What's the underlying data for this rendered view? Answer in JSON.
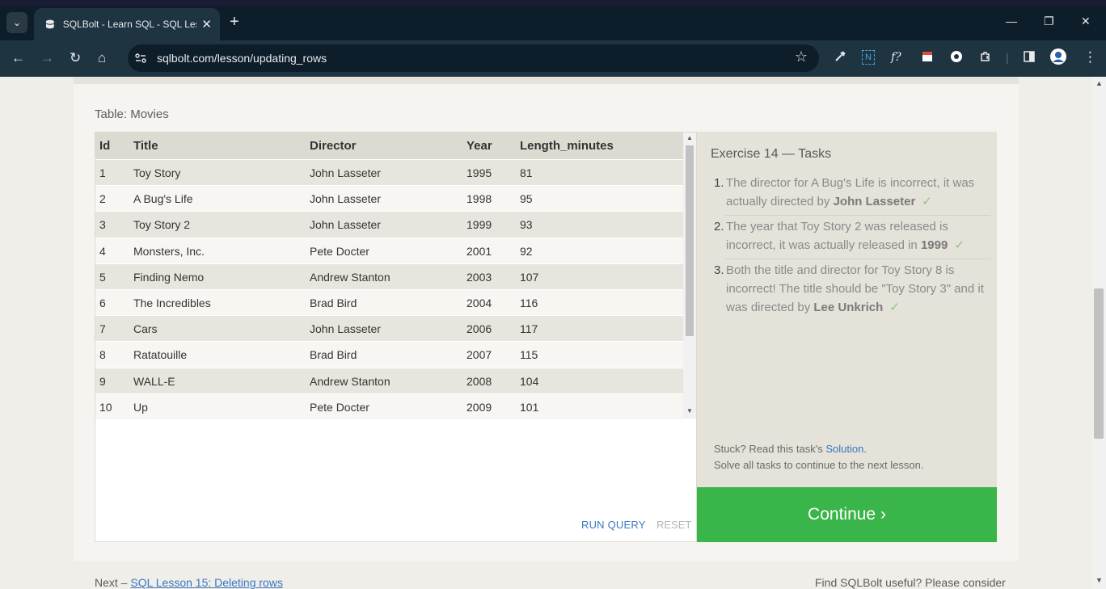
{
  "browser": {
    "tab_title": "SQLBolt - Learn SQL - SQL Lesson",
    "tab_close": "✕",
    "new_tab": "+",
    "url": "sqlbolt.com/lesson/updating_rows",
    "window_controls": {
      "minimize": "—",
      "maximize": "❐",
      "close": "✕"
    },
    "nav": {
      "back": "←",
      "forward": "→",
      "reload": "↻",
      "home": "⌂"
    },
    "icons": [
      "arrow-left-icon",
      "arrow-right-icon",
      "reload-icon",
      "home-icon",
      "star-icon",
      "eyedropper-icon",
      "n-extension-icon",
      "function-extension-icon",
      "notes-extension-icon",
      "circle-extension-icon",
      "puzzle-extension-icon",
      "sidepanel-icon",
      "profile-avatar",
      "menu-kebab-icon"
    ],
    "extensions": {
      "fx": "f?",
      "n": "N",
      "menu": "⋮"
    }
  },
  "lesson": {
    "table_label": "Table: Movies",
    "columns": [
      "Id",
      "Title",
      "Director",
      "Year",
      "Length_minutes"
    ],
    "rows": [
      [
        "1",
        "Toy Story",
        "John Lasseter",
        "1995",
        "81"
      ],
      [
        "2",
        "A Bug's Life",
        "John Lasseter",
        "1998",
        "95"
      ],
      [
        "3",
        "Toy Story 2",
        "John Lasseter",
        "1999",
        "93"
      ],
      [
        "4",
        "Monsters, Inc.",
        "Pete Docter",
        "2001",
        "92"
      ],
      [
        "5",
        "Finding Nemo",
        "Andrew Stanton",
        "2003",
        "107"
      ],
      [
        "6",
        "The Incredibles",
        "Brad Bird",
        "2004",
        "116"
      ],
      [
        "7",
        "Cars",
        "John Lasseter",
        "2006",
        "117"
      ],
      [
        "8",
        "Ratatouille",
        "Brad Bird",
        "2007",
        "115"
      ],
      [
        "9",
        "WALL-E",
        "Andrew Stanton",
        "2008",
        "104"
      ],
      [
        "10",
        "Up",
        "Pete Docter",
        "2009",
        "101"
      ]
    ],
    "run_query": "RUN QUERY",
    "reset": "RESET"
  },
  "exercise": {
    "title": "Exercise 14 — Tasks",
    "tasks": [
      {
        "num": "1.",
        "text": "The director for A Bug's Life is incorrect, it was actually directed by ",
        "bold": "John Lasseter",
        "check": "✓"
      },
      {
        "num": "2.",
        "text": "The year that Toy Story 2 was released is incorrect, it was actually released in ",
        "bold": "1999",
        "check": "✓"
      },
      {
        "num": "3.",
        "text": "Both the title and director for Toy Story 8 is incorrect! The title should be \"Toy Story 3\" and it was directed by ",
        "bold": "Lee Unkrich",
        "check": "✓"
      }
    ],
    "stuck_prefix": "Stuck? Read this task's ",
    "solution_link": "Solution",
    "stuck_suffix": ".",
    "solve_all": "Solve all tasks to continue to the next lesson.",
    "continue": "Continue ›"
  },
  "footer": {
    "next_prefix": "Next – ",
    "next_link": "SQL Lesson 15: Deleting rows",
    "right_text": "Find SQLBolt useful? Please consider"
  },
  "colors": {
    "accent_green": "#3ab54a",
    "link_blue": "#3a77c2",
    "chrome_dark": "#0d1d2a",
    "chrome_toolbar": "#1f3441"
  }
}
